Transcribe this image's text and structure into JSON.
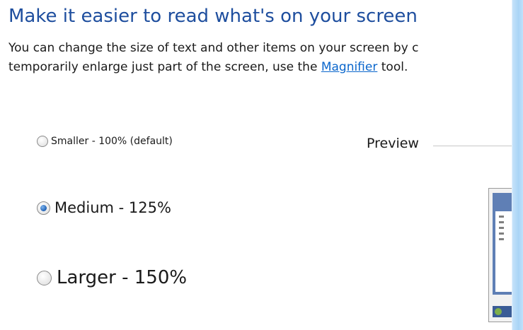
{
  "header": {
    "title": "Make it easier to read what's on your screen"
  },
  "description": {
    "line1": "You can change the size of text and other items on your screen by c",
    "line2_prefix": "temporarily enlarge just part of the screen, use the ",
    "link": "Magnifier",
    "line2_suffix": " tool."
  },
  "options": [
    {
      "label": "Smaller - 100% (default)",
      "selected": false
    },
    {
      "label": "Medium - 125%",
      "selected": true
    },
    {
      "label": "Larger - 150%",
      "selected": false
    }
  ],
  "preview": {
    "label": "Preview"
  },
  "colors": {
    "title": "#1e4e9e",
    "link": "#0a66cc",
    "right_strip": "#a9d4f6"
  },
  "icons": [
    "radio-unchecked-icon",
    "radio-checked-icon",
    "preview-screen-thumbnail"
  ]
}
